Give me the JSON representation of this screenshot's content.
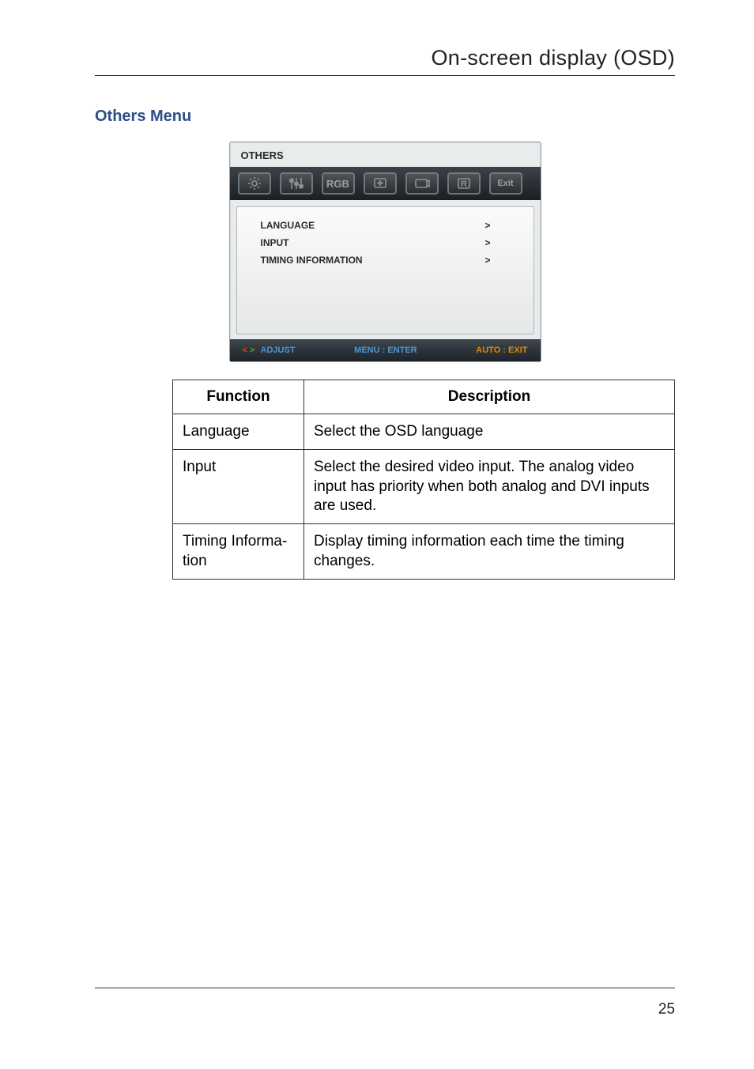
{
  "header": {
    "title": "On-screen display (OSD)"
  },
  "section": {
    "heading": "Others Menu"
  },
  "osd": {
    "title": "OTHERS",
    "tabs": [
      "brightness-icon",
      "sliders-icon",
      "rgb-icon",
      "position-icon",
      "clock-icon",
      "r-icon",
      "exit-icon"
    ],
    "tab_labels": {
      "rgb": "RGB",
      "r": "R",
      "exit": "Exit"
    },
    "rows": [
      {
        "label": "LANGUAGE",
        "value": ">"
      },
      {
        "label": "INPUT",
        "value": ">"
      },
      {
        "label": "TIMING INFORMATION",
        "value": ">"
      }
    ],
    "footer": {
      "adjust_prefix_lt": "<",
      "adjust_prefix_gt": ">",
      "adjust_label": "ADJUST",
      "menu_label": "MENU : ENTER",
      "auto_label": "AUTO : EXIT"
    }
  },
  "table": {
    "headers": {
      "function": "Function",
      "description": "Description"
    },
    "rows": [
      {
        "function": "Language",
        "description": "Select the OSD language"
      },
      {
        "function": "Input",
        "description": "Select the desired video input. The analog video input has priority when both analog and DVI inputs are used."
      },
      {
        "function": "Timing Informa­tion",
        "description": "Display timing information each time the timing changes."
      }
    ]
  },
  "page_number": "25"
}
